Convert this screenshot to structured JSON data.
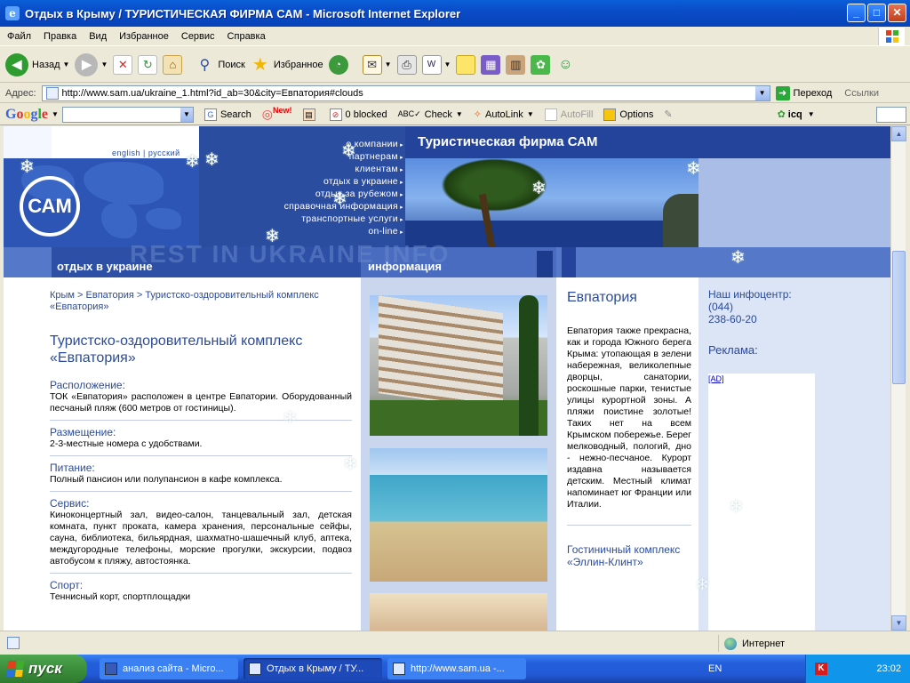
{
  "window": {
    "title": "Отдых в Крыму / ТУРИСТИЧЕСКАЯ ФИРМА САМ - Microsoft Internet Explorer"
  },
  "menu": [
    "Файл",
    "Правка",
    "Вид",
    "Избранное",
    "Сервис",
    "Справка"
  ],
  "toolbar": {
    "back": "Назад",
    "search": "Поиск",
    "favorites": "Избранное"
  },
  "address": {
    "label": "Адрес:",
    "url": "http://www.sam.ua/ukraine_1.html?id_ab=30&city=Евпатория#clouds",
    "go": "Переход",
    "links": "Ссылки"
  },
  "google_bar": {
    "logo": "Google",
    "search": "Search",
    "new_badge": "New!",
    "blocked": "0 blocked",
    "check": "Check",
    "autolink": "AutoLink",
    "autofill": "AutoFill",
    "options": "Options",
    "icq": "icq"
  },
  "site": {
    "lang_switch": "english | русский",
    "nav": [
      "о компании",
      "партнерам",
      "клиентам",
      "отдых в украине",
      "отдых за рубежом",
      "справочная информация",
      "транспортные услуги",
      "on-line"
    ],
    "brand": "Туристическая фирма САМ",
    "logo_text": "САМ",
    "watermark": "REST IN UKRAINE  INFO",
    "tab_left": "отдых в украине",
    "tab_right": "информация"
  },
  "left": {
    "breadcrumb": "Крым > Евпатория > Туристско-оздоровительный комплекс «Евпатория»",
    "title": "Туристско-оздоровительный комплекс «Евпатория»",
    "sections": [
      {
        "heading": "Расположение:",
        "text": "ТОК «Евпатория» расположен в центре Евпатории. Оборудованный песчаный пляж (600 метров от гостиницы)."
      },
      {
        "heading": "Размещение:",
        "text": "2-3-местные номера с удобствами."
      },
      {
        "heading": "Питание:",
        "text": "Полный пансион или полупансион в кафе комплекса."
      },
      {
        "heading": "Сервис:",
        "text": "Киноконцертный зал, видео-салон, танцевальный зал, детская комната, пункт проката, камера хранения, персональные сейфы, сауна, библиотека, бильярдная, шахматно-шашечный клуб, аптека, междугородные телефоны, морские прогулки, экскурсии, подвоз автобусом к пляжу, автостоянка."
      },
      {
        "heading": "Спорт:",
        "text": "Теннисный корт, спортплощадки"
      }
    ]
  },
  "city": {
    "title": "Евпатория",
    "text": "Евпатория также прекрасна, как и города Южного берега Крыма: утопающая в зелени набережная, великолепные дворцы, санатории, роскошные парки, тенистые улицы курортной зоны. А пляжи поистине золотые! Таких нет на всем Крымском побережье. Берег мелководный, пологий, дно - нежно-песчаное. Курорт издавна называется детским. Местный климат напоминает юг Франции или Италии.",
    "next": "Гостиничный комплекс «Эллин-Клинт»"
  },
  "right": {
    "info_label": "Наш инфоцентр:",
    "info_code": "(044)",
    "info_phone": "238-60-20",
    "ads_title": "Реклама:",
    "ad_link": "[AD]"
  },
  "status": {
    "zone": "Интернет"
  },
  "taskbar": {
    "start": "пуск",
    "tasks": [
      "анализ сайта - Micro...",
      "Отдых в Крыму / ТУ...",
      "http://www.sam.ua -..."
    ],
    "lang": "EN",
    "time": "23:02"
  }
}
